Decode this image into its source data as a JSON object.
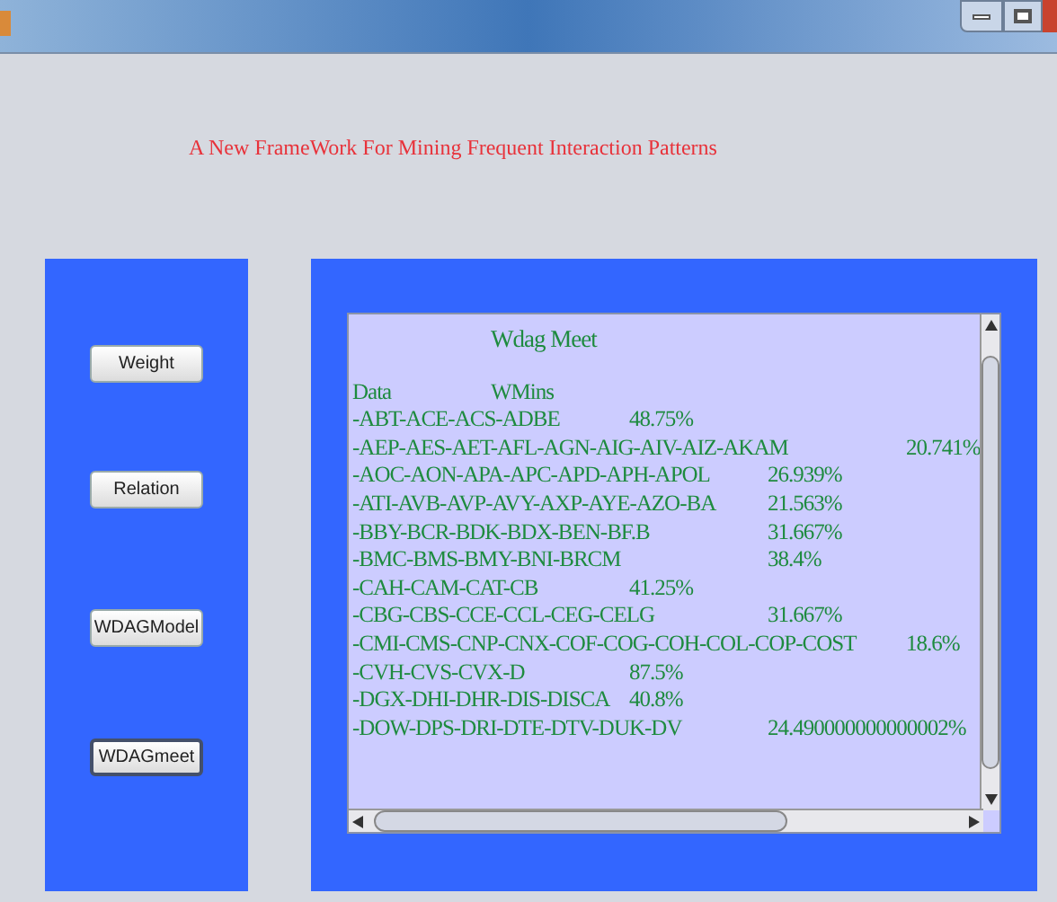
{
  "heading": "A New FrameWork For Mining Frequent Interaction Patterns",
  "buttons": [
    {
      "label": "Weight",
      "focused": false
    },
    {
      "label": "Relation",
      "focused": false
    },
    {
      "label": "WDAGModel",
      "focused": false
    },
    {
      "label": "WDAGmeet",
      "focused": true
    }
  ],
  "output": {
    "title": "Wdag Meet",
    "columns": [
      "Data",
      "WMins"
    ],
    "rows": [
      {
        "data": "-ABT-ACE-ACS-ADBE",
        "value": "48.75%"
      },
      {
        "data": "-AEP-AES-AET-AFL-AGN-AIG-AIV-AIZ-AKAM",
        "value": "20.741%"
      },
      {
        "data": "-AOC-AON-APA-APC-APD-APH-APOL",
        "value": "26.939%"
      },
      {
        "data": "-ATI-AVB-AVP-AVY-AXP-AYE-AZO-BA",
        "value": "21.563%"
      },
      {
        "data": "-BBY-BCR-BDK-BDX-BEN-BF.B",
        "value": "31.667%"
      },
      {
        "data": "-BMC-BMS-BMY-BNI-BRCM",
        "value": "38.4%"
      },
      {
        "data": "-CAH-CAM-CAT-CB",
        "value": "41.25%"
      },
      {
        "data": "-CBG-CBS-CCE-CCL-CEG-CELG",
        "value": "31.667%"
      },
      {
        "data": "-CMI-CMS-CNP-CNX-COF-COG-COH-COL-COP-COST",
        "value": "18.6%"
      },
      {
        "data": "-CVH-CVS-CVX-D",
        "value": "87.5%"
      },
      {
        "data": "-DGX-DHI-DHR-DIS-DISCA",
        "value": "40.8%"
      },
      {
        "data": "-DOW-DPS-DRI-DTE-DTV-DUK-DV",
        "value": "24.490000000000002%"
      }
    ]
  }
}
